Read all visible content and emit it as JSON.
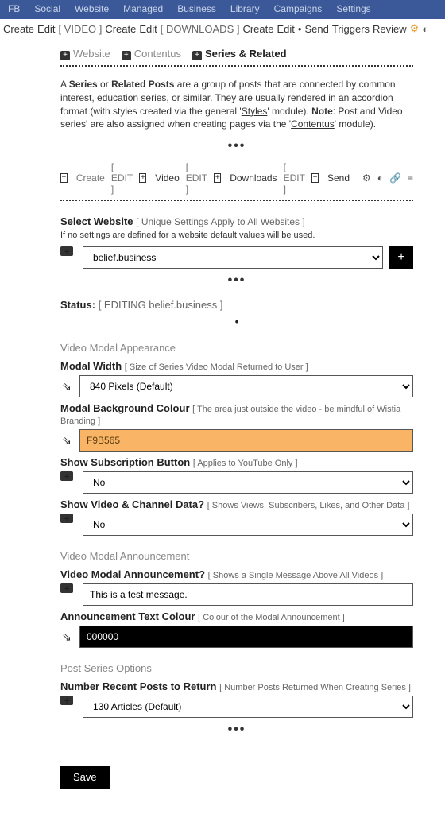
{
  "topnav": [
    "FB",
    "Social",
    "Website",
    "Managed",
    "Business",
    "Library",
    "Campaigns",
    "Settings"
  ],
  "subnav": {
    "g1": [
      "Create",
      "Edit"
    ],
    "b1": "[ VIDEO ]",
    "g2": [
      "Create",
      "Edit"
    ],
    "b2": "[ DOWNLOADS ]",
    "g3": [
      "Create",
      "Edit"
    ],
    "dot": "•",
    "g4": [
      "Send",
      "Triggers",
      "Review"
    ]
  },
  "tabs": {
    "website": "Website",
    "contentus": "Contentus",
    "series": "Series & Related"
  },
  "intro": {
    "p1a": "A ",
    "p1b": "Series",
    "p1c": " or ",
    "p1d": "Related Posts",
    "p1e": " are a group of posts that are connected by common interest, education series, or similar. They are usually rendered in an accordion format (with styles created via the general '",
    "p1f": "Styles",
    "p1g": "' module). ",
    "p1h": "Note",
    "p1i": ": Post and Video series' are also assigned when creating pages via the '",
    "p1j": "Contentus",
    "p1k": "' module)."
  },
  "tabs2": {
    "create": "Create",
    "edit1": "[ EDIT ]",
    "video": "Video",
    "edit2": "[ EDIT ]",
    "downloads": "Downloads",
    "edit3": "[ EDIT ]",
    "send": "Send"
  },
  "selectWebsite": {
    "label": "Select Website",
    "hint": "[ Unique Settings Apply to All Websites ]",
    "sub": "If no settings are defined for a website default values will be used.",
    "value": "belief.business"
  },
  "status": {
    "label": "Status:",
    "bracket": "[ EDITING belief.business ]"
  },
  "vmAppearance": "Video Modal Appearance",
  "modalWidth": {
    "label": "Modal Width",
    "hint": "[ Size of Series Video Modal Returned to User ]",
    "value": "840 Pixels (Default)"
  },
  "modalBg": {
    "label": "Modal Background Colour",
    "hint": "[ The area just outside the video - be mindful of Wistia Branding ]",
    "value": "F9B565"
  },
  "subBtn": {
    "label": "Show Subscription Button",
    "hint": "[ Applies to YouTube Only ]",
    "value": "No"
  },
  "chanData": {
    "label": "Show Video & Channel Data?",
    "hint": "[ Shows Views, Subscribers, Likes, and Other Data ]",
    "value": "No"
  },
  "vmAnnounce": "Video Modal Announcement",
  "announceQ": {
    "label": "Video Modal Announcement?",
    "hint": "[ Shows a Single Message Above All Videos ]",
    "value": "This is a test message."
  },
  "announceColor": {
    "label": "Announcement Text Colour",
    "hint": "[ Colour of the Modal Announcement ]",
    "value": "000000"
  },
  "postSeries": "Post Series Options",
  "numPosts": {
    "label": "Number Recent Posts to Return",
    "hint": "[ Number Posts Returned When Creating Series ]",
    "value": "130 Articles (Default)"
  },
  "save": "Save",
  "icons": {
    "bucket": "🗑",
    "gear": "⚙",
    "pie": "◐",
    "link": "🔗",
    "menu": "≡",
    "plus": "+"
  }
}
